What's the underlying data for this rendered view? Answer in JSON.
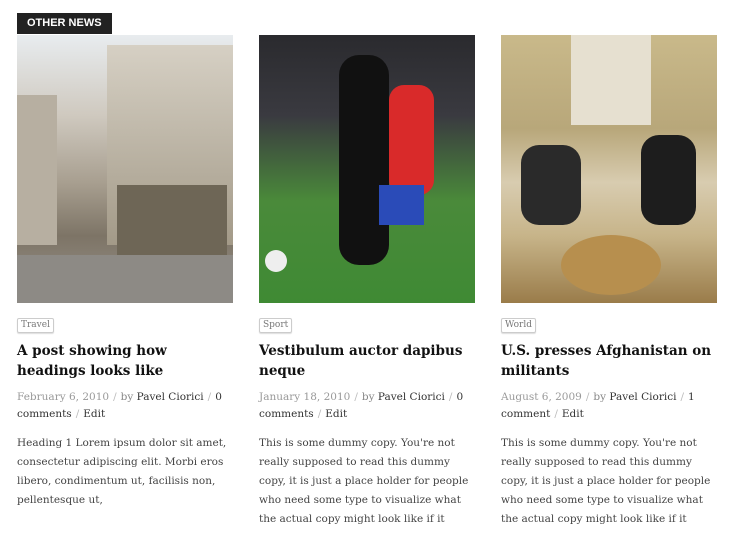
{
  "section": {
    "title": "OTHER NEWS"
  },
  "posts": [
    {
      "category": "Travel",
      "title": "A post showing how headings looks like",
      "date": "February 6, 2010",
      "by": "by",
      "author": "Pavel Ciorici",
      "comments": "0 comments",
      "edit": "Edit",
      "excerpt": "Heading 1 Lorem ipsum dolor sit amet, consectetur adipiscing elit. Morbi eros libero, condimentum ut, facilisis non, pellentesque ut,",
      "image": "city-street-photo"
    },
    {
      "category": "Sport",
      "title": "Vestibulum auctor dapibus neque",
      "date": "January 18, 2010",
      "by": "by",
      "author": "Pavel Ciorici",
      "comments": "0 comments",
      "edit": "Edit",
      "excerpt": "This is some dummy copy. You're not really supposed to read this dummy copy, it is just a place holder for people who need some type to visualize what the actual copy might look like if it",
      "image": "soccer-players-photo"
    },
    {
      "category": "World",
      "title": "U.S. presses Afghanistan on militants",
      "date": "August 6, 2009",
      "by": "by",
      "author": "Pavel Ciorici",
      "comments": "1 comment",
      "edit": "Edit",
      "excerpt": "This is some dummy copy. You're not really supposed to read this dummy copy, it is just a place holder for people who need some type to visualize what the actual copy might look like if it",
      "image": "oval-office-photo"
    }
  ]
}
